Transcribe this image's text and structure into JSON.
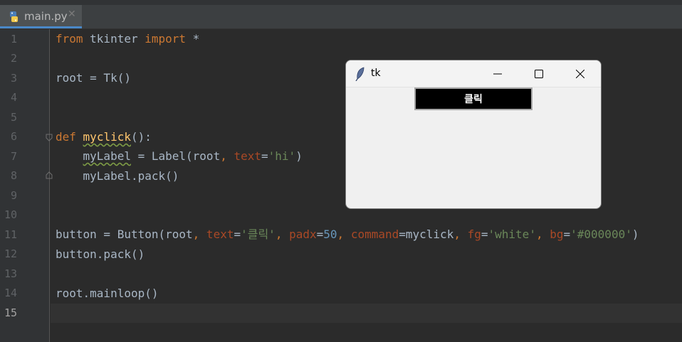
{
  "tab": {
    "filename": "main.py",
    "close_glyph": "✕",
    "icon": "python-file-icon"
  },
  "lines": [
    {
      "n": "1",
      "text": "from tkinter import *"
    },
    {
      "n": "2",
      "text": ""
    },
    {
      "n": "3",
      "text": "root = Tk()"
    },
    {
      "n": "4",
      "text": ""
    },
    {
      "n": "5",
      "text": ""
    },
    {
      "n": "6",
      "text": "def myclick():"
    },
    {
      "n": "7",
      "text": "    myLabel = Label(root, text='hi')"
    },
    {
      "n": "8",
      "text": "    myLabel.pack()"
    },
    {
      "n": "9",
      "text": ""
    },
    {
      "n": "10",
      "text": ""
    },
    {
      "n": "11",
      "text": "button = Button(root, text='클릭', padx=50, command=myclick, fg='white', bg='#000000')"
    },
    {
      "n": "12",
      "text": "button.pack()"
    },
    {
      "n": "13",
      "text": ""
    },
    {
      "n": "14",
      "text": "root.mainloop()"
    },
    {
      "n": "15",
      "text": ""
    }
  ],
  "code": {
    "l1": {
      "kw1": "from",
      "mod": " tkinter ",
      "kw2": "import",
      "rest": " *"
    },
    "l3": "root = Tk()",
    "l6": {
      "kw": "def",
      "sp": " ",
      "fn": "myclick",
      "rest": "():"
    },
    "l7": {
      "indent": "    ",
      "var": "myLabel",
      "a": " = Label(root",
      "comma": ",",
      "sp": " ",
      "param": "text",
      "eq": "=",
      "str": "'hi'",
      "close": ")"
    },
    "l8": {
      "indent": "    ",
      "text": "myLabel.pack()"
    },
    "l11": {
      "a": "button = Button(root",
      "c1": ",",
      "p1": " text",
      "e1": "=",
      "s1": "'클릭'",
      "c2": ",",
      "p2": " padx",
      "e2": "=",
      "n1": "50",
      "c3": ",",
      "p3": " command",
      "e3": "=",
      "v3": "myclick",
      "c4": ",",
      "p4": " fg",
      "e4": "=",
      "s4": "'white'",
      "c5": ",",
      "p5": " bg",
      "e5": "=",
      "s5": "'#000000'",
      "close": ")"
    },
    "l12": "button.pack()",
    "l14": "root.mainloop()"
  },
  "current_line": 15,
  "tk_window": {
    "title": "tk",
    "icon": "feather-icon",
    "controls": {
      "minimize": "minimize-icon",
      "maximize": "maximize-icon",
      "close": "close-icon"
    },
    "button_label": "클릭",
    "button_fg": "#ffffff",
    "button_bg": "#000000"
  },
  "colors": {
    "editor_bg": "#2b2b2b",
    "keyword": "#cc7832",
    "string": "#6a8759",
    "number": "#6897bb",
    "param": "#aa4926",
    "function": "#ffc66d",
    "text": "#a9b7c6",
    "line_number": "#606366"
  }
}
